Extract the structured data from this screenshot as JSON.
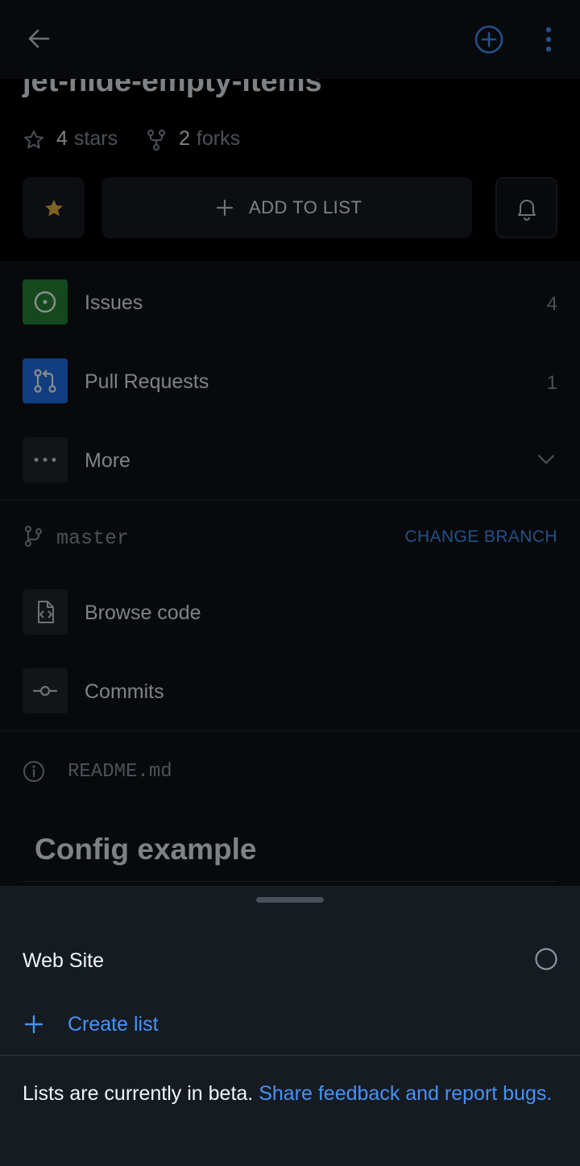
{
  "repo": {
    "title": "jet-hide-empty-items",
    "stars_count": "4",
    "stars_label": "stars",
    "forks_count": "2",
    "forks_label": "forks",
    "add_to_list_label": "ADD TO LIST"
  },
  "menu": {
    "issues": {
      "label": "Issues",
      "count": "4"
    },
    "pull_requests": {
      "label": "Pull Requests",
      "count": "1"
    },
    "more": {
      "label": "More"
    }
  },
  "branch": {
    "name": "master",
    "change_label": "CHANGE BRANCH"
  },
  "code": {
    "browse_label": "Browse code",
    "commits_label": "Commits"
  },
  "readme": {
    "filename": "README.md",
    "heading": "Config example"
  },
  "sheet": {
    "list_item_label": "Web Site",
    "create_list_label": "Create list",
    "beta_text": "Lists are currently in beta.",
    "feedback_link": "Share feedback and report bugs."
  },
  "colors": {
    "accent": "#4493f8",
    "issues_icon_bg": "#238636",
    "pr_icon_bg": "#1f6feb",
    "star_fill": "#e3b341"
  }
}
